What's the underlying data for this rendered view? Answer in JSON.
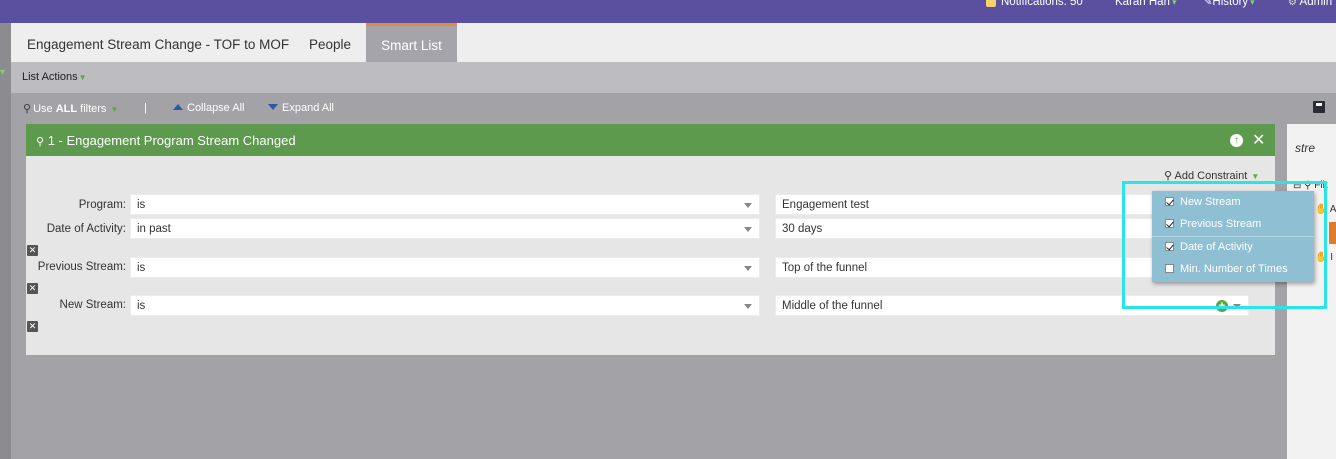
{
  "topbar": {
    "notifications": "Notifications: 50",
    "user": "Karan Hari",
    "history": "History",
    "admin": "Admin"
  },
  "tabs": [
    {
      "label": "Engagement Stream Change - TOF to MOF"
    },
    {
      "label": "People"
    },
    {
      "label": "Smart List"
    }
  ],
  "actions": {
    "list_actions": "List Actions"
  },
  "toolbar": {
    "use_prefix": "Use",
    "use_bold": "ALL",
    "use_suffix": "filters",
    "divider": "|",
    "collapse": "Collapse All",
    "expand": "Expand All"
  },
  "filter": {
    "title": "1 - Engagement Program Stream Changed",
    "add_constraint": "Add Constraint",
    "rows": [
      {
        "label": "Program:",
        "operator": "is",
        "value": "Engagement test"
      },
      {
        "label": "Date of Activity:",
        "operator": "in past",
        "value": "30 days"
      },
      {
        "label": "Previous Stream:",
        "operator": "is",
        "value": "Top of the funnel"
      },
      {
        "label": "New Stream:",
        "operator": "is",
        "value": "Middle of the funnel"
      }
    ]
  },
  "constraint_menu": {
    "items": [
      {
        "label": "New Stream",
        "checked": true
      },
      {
        "label": "Previous Stream",
        "checked": true
      },
      {
        "label": "Date of Activity",
        "checked": true
      },
      {
        "label": "Min. Number of Times",
        "checked": false
      }
    ]
  },
  "right_panel": {
    "search_text": "stre",
    "items": [
      "Filt",
      "A",
      "I"
    ]
  },
  "colors": {
    "topbar": "#5b4fa0",
    "header_green": "#5e9a4e",
    "tab_accent": "#e48b3c",
    "menu_bg": "#8fbfd2",
    "highlight": "#29e4e8"
  }
}
